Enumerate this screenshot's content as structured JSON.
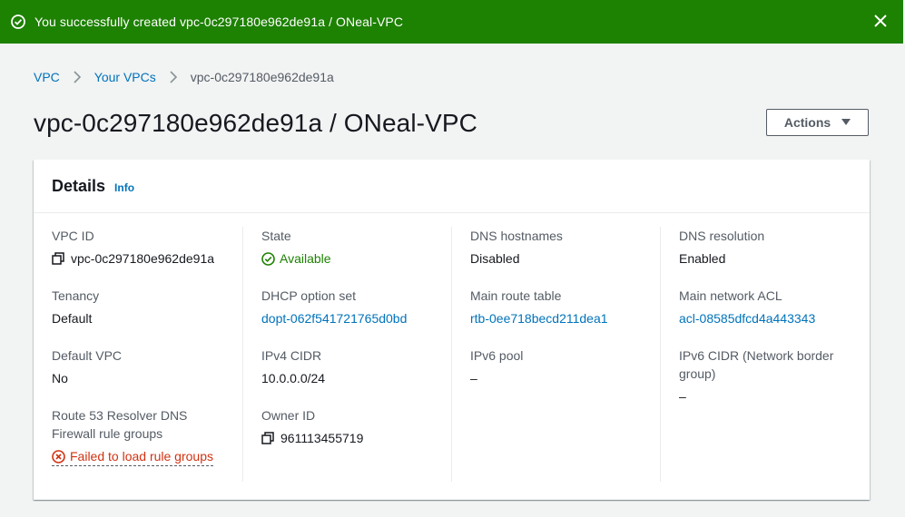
{
  "flash": {
    "message": "You successfully created vpc-0c297180e962de91a / ONeal-VPC",
    "color": "#1d8102"
  },
  "breadcrumb": {
    "items": [
      "VPC",
      "Your VPCs"
    ],
    "current": "vpc-0c297180e962de91a"
  },
  "page": {
    "title": "vpc-0c297180e962de91a / ONeal-VPC",
    "actions_label": "Actions"
  },
  "details": {
    "heading": "Details",
    "info_label": "Info",
    "col1": {
      "vpc_id": {
        "label": "VPC ID",
        "value": "vpc-0c297180e962de91a"
      },
      "tenancy": {
        "label": "Tenancy",
        "value": "Default"
      },
      "default_vpc": {
        "label": "Default VPC",
        "value": "No"
      },
      "resolver": {
        "label": "Route 53 Resolver DNS Firewall rule groups",
        "value": "Failed to load rule groups"
      }
    },
    "col2": {
      "state": {
        "label": "State",
        "value": "Available"
      },
      "dhcp": {
        "label": "DHCP option set",
        "value": "dopt-062f541721765d0bd"
      },
      "ipv4": {
        "label": "IPv4 CIDR",
        "value": "10.0.0.0/24"
      },
      "owner": {
        "label": "Owner ID",
        "value": "961113455719"
      }
    },
    "col3": {
      "dns_hostnames": {
        "label": "DNS hostnames",
        "value": "Disabled"
      },
      "route_table": {
        "label": "Main route table",
        "value": "rtb-0ee718becd211dea1"
      },
      "ipv6_pool": {
        "label": "IPv6 pool",
        "value": "–"
      }
    },
    "col4": {
      "dns_resolution": {
        "label": "DNS resolution",
        "value": "Enabled"
      },
      "network_acl": {
        "label": "Main network ACL",
        "value": "acl-08585dfcd4a443343"
      },
      "ipv6_cidr": {
        "label": "IPv6 CIDR (Network border group)",
        "value": "–"
      }
    }
  },
  "colors": {
    "link": "#0073bb",
    "success": "#1d8102",
    "error": "#d13212"
  }
}
